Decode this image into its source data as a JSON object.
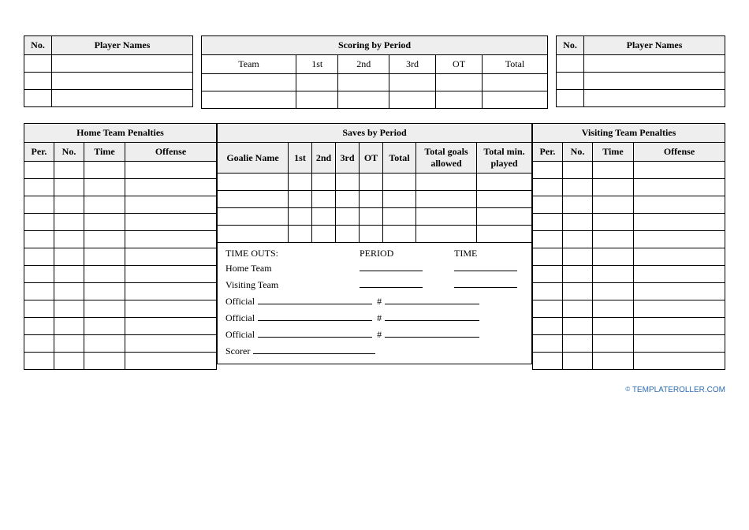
{
  "players": {
    "no_header": "No.",
    "names_header": "Player Names"
  },
  "scoring": {
    "title": "Scoring by Period",
    "cols": {
      "team": "Team",
      "p1": "1st",
      "p2": "2nd",
      "p3": "3rd",
      "ot": "OT",
      "total": "Total"
    }
  },
  "penalties": {
    "home_title": "Home Team Penalties",
    "visit_title": "Visiting Team Penalties",
    "cols": {
      "per": "Per.",
      "no": "No.",
      "time": "Time",
      "offense": "Offense"
    }
  },
  "saves": {
    "title": "Saves by Period",
    "cols": {
      "goalie": "Goalie Name",
      "p1": "1st",
      "p2": "2nd",
      "p3": "3rd",
      "ot": "OT",
      "total": "Total",
      "tga": "Total goals allowed",
      "tmp": "Total min. played"
    }
  },
  "sign": {
    "timeouts": "TIME OUTS:",
    "period": "PERIOD",
    "time": "TIME",
    "home": "Home Team",
    "visit": "Visiting Team",
    "official": "Official",
    "hash": "#",
    "scorer": "Scorer"
  },
  "footer": {
    "copy": "©",
    "site": "TEMPLATEROLLER.COM"
  }
}
